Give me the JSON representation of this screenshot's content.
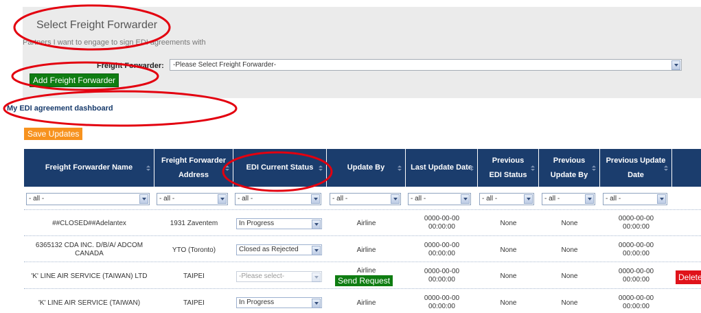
{
  "select_panel": {
    "title": "Select Freight Forwarder",
    "subtitle": "Partners I want to engage to sign EDI agreements with",
    "ff_label": "Freight Forwarder:",
    "ff_select_value": "-Please Select Freight Forwarder-",
    "add_button": "Add Freight Forwarder"
  },
  "dashboard": {
    "title": "My EDI agreement dashboard",
    "save_button": "Save Updates"
  },
  "table": {
    "headers": [
      "Freight Forwarder Name",
      "Freight Forwarder Address",
      "EDI Current Status",
      "Update By",
      "Last Update Date",
      "Previous EDI Status",
      "Previous Update By",
      "Previous Update Date"
    ],
    "filter_value": "- all -",
    "rows": [
      {
        "name": "##CLOSED##Adelantex",
        "address": "1931 Zaventem",
        "status": "In Progress",
        "update_by": "Airline",
        "last_date": "0000-00-00",
        "last_time": "00:00:00",
        "prev_status": "None",
        "prev_by": "None",
        "prev_date": "0000-00-00",
        "prev_time": "00:00:00"
      },
      {
        "name": "6365132 CDA INC. D/B/A/ ADCOM CANADA",
        "address": "YTO (Toronto)",
        "status": "Closed as Rejected",
        "update_by": "Airline",
        "last_date": "0000-00-00",
        "last_time": "00:00:00",
        "prev_status": "None",
        "prev_by": "None",
        "prev_date": "0000-00-00",
        "prev_time": "00:00:00"
      },
      {
        "name": "'K' LINE AIR SERVICE (TAIWAN) LTD",
        "address": "TAIPEI",
        "status": "-Please select-",
        "update_by": "Airline",
        "last_date": "0000-00-00",
        "last_time": "00:00:00",
        "prev_status": "None",
        "prev_by": "None",
        "prev_date": "0000-00-00",
        "prev_time": "00:00:00",
        "send_button": "Send Request",
        "delete_button": "Delete"
      },
      {
        "name": "'K' LINE AIR SERVICE (TAIWAN)",
        "address": "TAIPEI",
        "status": "In Progress",
        "update_by": "Airline",
        "last_date": "0000-00-00",
        "last_time": "00:00:00",
        "prev_status": "None",
        "prev_by": "None",
        "prev_date": "0000-00-00",
        "prev_time": "00:00:00"
      }
    ]
  },
  "colors": {
    "header_bg": "#1b3d6d",
    "green_button": "#0f7d12",
    "orange_button": "#f7921e",
    "delete_button": "#e0121a",
    "annotation": "#e3000f"
  }
}
